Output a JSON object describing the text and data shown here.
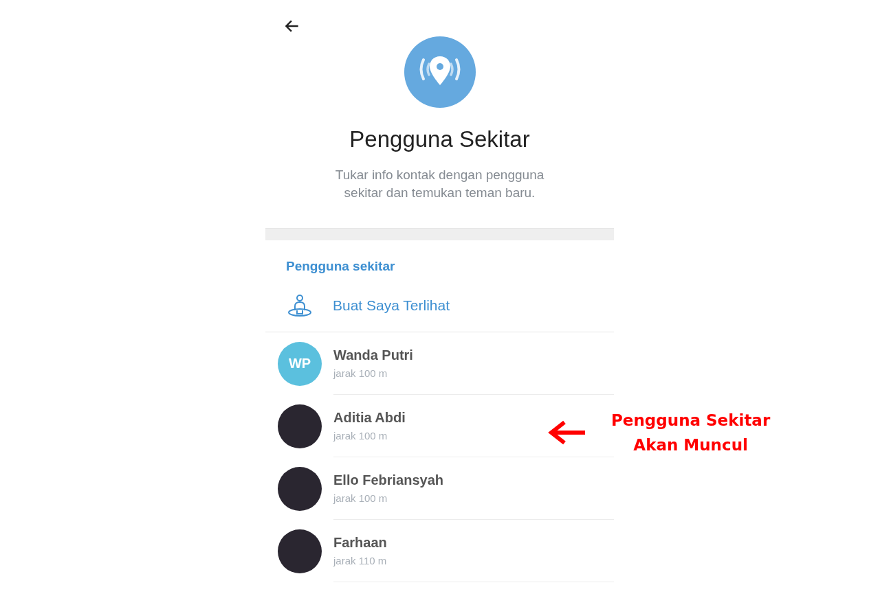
{
  "header": {
    "title": "Pengguna Sekitar",
    "subtitle": "Tukar info kontak dengan pengguna sekitar dan temukan teman baru."
  },
  "section": {
    "heading": "Pengguna sekitar",
    "action": "Buat Saya Terlihat"
  },
  "users": [
    {
      "name": "Wanda Putri",
      "distance": "jarak 100 m",
      "avatar": {
        "kind": "initials",
        "text": "WP",
        "color": "#5bc0de"
      }
    },
    {
      "name": "Aditia Abdi",
      "distance": "jarak 100 m",
      "avatar": {
        "kind": "photo"
      }
    },
    {
      "name": "Ello Febriansyah",
      "distance": "jarak 100 m",
      "avatar": {
        "kind": "photo"
      }
    },
    {
      "name": "Farhaan",
      "distance": "jarak 110 m",
      "avatar": {
        "kind": "photo"
      }
    }
  ],
  "annotation": {
    "lines": [
      "Pengguna Sekitar",
      "Akan Muncul"
    ]
  }
}
